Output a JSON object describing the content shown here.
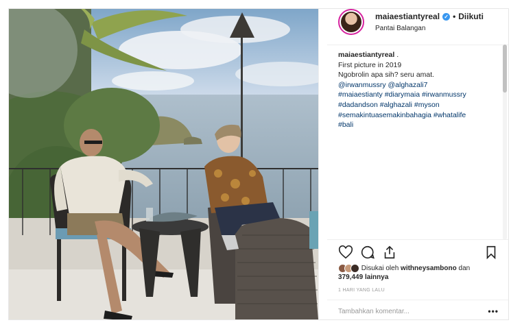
{
  "post": {
    "username": "maiaestiantyreal",
    "follow_status": "Diikuti",
    "separator": "•",
    "location": "Pantai Balangan",
    "caption": {
      "username": "maiaestiantyreal",
      "after_user": " .",
      "lines": [
        "First picture in 2019",
        "Ngobrolin apa sih? seru amat."
      ],
      "mentions": "@irwanmussry @alghazali7",
      "hashtag_lines": [
        "#maiaestianty #diarymaia #irwanmussry",
        "#dadandson #alghazali #myson",
        "#semakintuasemakinbahagia #whatalife",
        "#bali"
      ]
    },
    "likes": {
      "prefix": "Disukai oleh",
      "user": "withneysambono",
      "connector": "dan",
      "count": "379,449",
      "suffix": "lainnya"
    },
    "time_ago": "1 HARI YANG LALU",
    "comment_placeholder": "Tambahkan komentar...",
    "more_options": "•••"
  },
  "icons": {
    "verified": "verified-badge-icon",
    "like": "heart-icon",
    "comment": "comment-icon",
    "share": "share-icon",
    "save": "bookmark-icon",
    "more": "more-options-icon"
  },
  "colors": {
    "verified": "#3897f0",
    "link": "#003569",
    "muted": "#999999",
    "border": "#e6e6e6",
    "avatar_ring": "#d6249f"
  }
}
